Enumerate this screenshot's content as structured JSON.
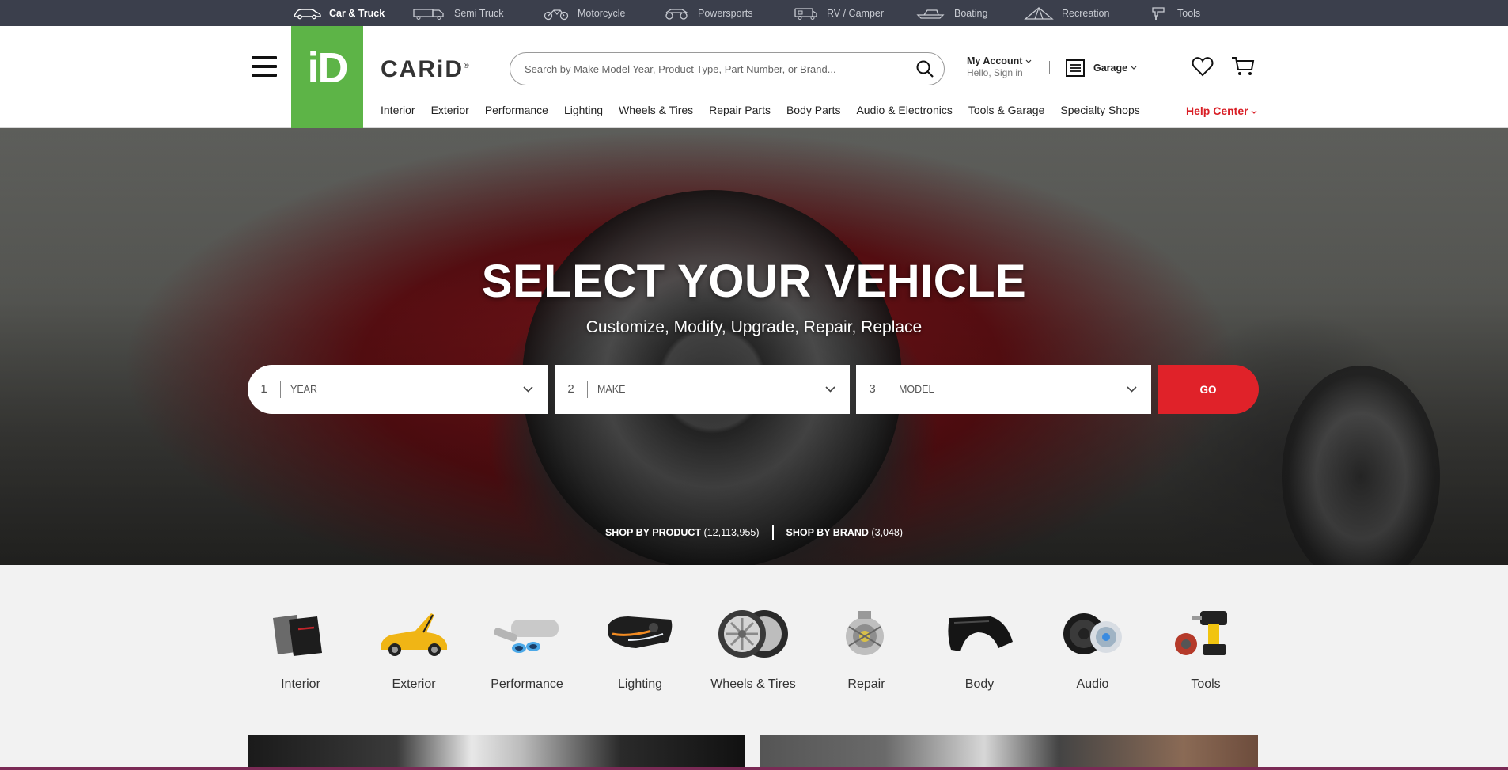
{
  "vehicle_types": [
    {
      "label": "Car & Truck",
      "icon": "car-icon",
      "active": true
    },
    {
      "label": "Semi Truck",
      "icon": "semi-truck-icon",
      "active": false
    },
    {
      "label": "Motorcycle",
      "icon": "motorcycle-icon",
      "active": false
    },
    {
      "label": "Powersports",
      "icon": "powersports-icon",
      "active": false
    },
    {
      "label": "RV / Camper",
      "icon": "rv-camper-icon",
      "active": false
    },
    {
      "label": "Boating",
      "icon": "boat-icon",
      "active": false
    },
    {
      "label": "Recreation",
      "icon": "tent-icon",
      "active": false
    },
    {
      "label": "Tools",
      "icon": "tools-icon",
      "active": false
    }
  ],
  "header": {
    "logo_mark": "iD",
    "brand": "CARiD",
    "brand_reg": "®",
    "search_placeholder": "Search by Make Model Year, Product Type, Part Number, or Brand...",
    "account_label": "My Account",
    "account_sub": "Hello, Sign in",
    "garage_label": "Garage"
  },
  "category_nav": [
    "Interior",
    "Exterior",
    "Performance",
    "Lighting",
    "Wheels & Tires",
    "Repair Parts",
    "Body Parts",
    "Audio & Electronics",
    "Tools & Garage",
    "Specialty Shops"
  ],
  "help_center": "Help Center",
  "hero": {
    "headline": "SELECT YOUR VEHICLE",
    "subheadline": "Customize, Modify, Upgrade, Repair, Replace",
    "selectors": [
      {
        "num": "1",
        "label": "YEAR"
      },
      {
        "num": "2",
        "label": "MAKE"
      },
      {
        "num": "3",
        "label": "MODEL"
      }
    ],
    "go_label": "GO",
    "shop_by_product": "SHOP BY PRODUCT",
    "product_count": "(12,113,955)",
    "shop_by_brand": "SHOP BY BRAND",
    "brand_count": "(3,048)"
  },
  "tiles": [
    {
      "label": "Interior"
    },
    {
      "label": "Exterior"
    },
    {
      "label": "Performance"
    },
    {
      "label": "Lighting"
    },
    {
      "label": "Wheels & Tires"
    },
    {
      "label": "Repair"
    },
    {
      "label": "Body"
    },
    {
      "label": "Audio"
    },
    {
      "label": "Tools"
    }
  ],
  "colors": {
    "brand_green": "#5db447",
    "accent_red": "#e02229",
    "topbar": "#3b3f4c"
  }
}
